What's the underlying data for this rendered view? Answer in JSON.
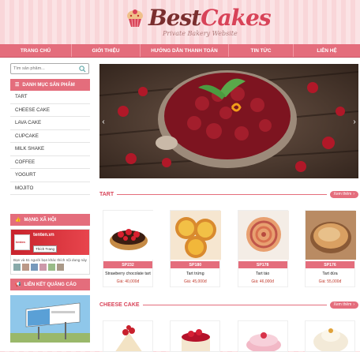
{
  "brand": {
    "logo_best": "Best",
    "logo_cakes": "Cakes",
    "tagline": "Private Bakery Website"
  },
  "nav": [
    "TRANG CHỦ",
    "GIỚI THIỆU",
    "HƯỚNG DẪN THANH TOÁN",
    "TIN TỨC",
    "LIÊN HỆ"
  ],
  "search": {
    "placeholder": "Tìm sản phẩm..."
  },
  "categories": {
    "title": "DANH MỤC SẢN PHẨM",
    "items": [
      "TART",
      "CHEESE CAKE",
      "LAVA CAKE",
      "CUPCAKE",
      "MILK SHAKE",
      "COFFEE",
      "YOGURT",
      "MOJITO"
    ]
  },
  "social": {
    "title": "MẠNG XÃ HỘI",
    "page_name": "tenten.vn",
    "like_label": "Thích Trang",
    "caption": "Bạn và 61 người bạn khác thích nội dung này"
  },
  "ads": {
    "title": "LIÊN KẾT QUẢNG CÁO"
  },
  "sections": [
    {
      "title": "TART",
      "more": "Xem thêm",
      "products": [
        {
          "code": "SP232",
          "name": "Strawberry chocolate tart",
          "price": "Giá: 40,000đ"
        },
        {
          "code": "SP180",
          "name": "Tart trứng",
          "price": "Giá: 45,000đ"
        },
        {
          "code": "SP178",
          "name": "Tart táo",
          "price": "Giá: 46,000đ"
        },
        {
          "code": "SP176",
          "name": "Tart dừa",
          "price": "Giá: 55,000đ"
        }
      ]
    },
    {
      "title": "CHEESE CAKE",
      "more": "Xem thêm"
    }
  ],
  "colors": {
    "accent": "#e46d7c",
    "brand": "#7a2e2e",
    "price": "#c0392b"
  }
}
